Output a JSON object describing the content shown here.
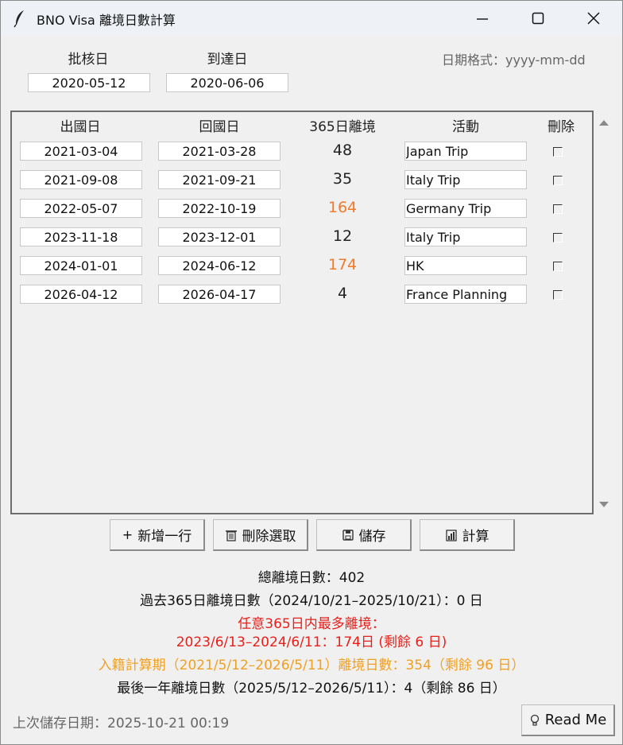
{
  "window": {
    "title": "BNO Visa 離境日數計算"
  },
  "header": {
    "approval_label": "批核日",
    "arrival_label": "到達日",
    "approval_value": "2020-05-12",
    "arrival_value": "2020-06-06",
    "date_format_hint": "日期格式：yyyy-mm-dd"
  },
  "table": {
    "columns": [
      "出國日",
      "回國日",
      "365日離境",
      "活動",
      "刪除"
    ],
    "rows": [
      {
        "depart": "2021-03-04",
        "return": "2021-03-28",
        "days": "48",
        "activity": "Japan Trip",
        "highlight": false
      },
      {
        "depart": "2021-09-08",
        "return": "2021-09-21",
        "days": "35",
        "activity": "Italy Trip",
        "highlight": false
      },
      {
        "depart": "2022-05-07",
        "return": "2022-10-19",
        "days": "164",
        "activity": "Germany Trip",
        "highlight": true
      },
      {
        "depart": "2023-11-18",
        "return": "2023-12-01",
        "days": "12",
        "activity": "Italy Trip",
        "highlight": false
      },
      {
        "depart": "2024-01-01",
        "return": "2024-06-12",
        "days": "174",
        "activity": "HK",
        "highlight": true
      },
      {
        "depart": "2026-04-12",
        "return": "2026-04-17",
        "days": "4",
        "activity": "France Planning",
        "highlight": false
      }
    ]
  },
  "buttons": {
    "add_row": "新增一行",
    "delete_selected": "刪除選取",
    "save": "儲存",
    "calculate": "計算",
    "readme": "Read Me"
  },
  "summary": {
    "total": "總離境日數：402",
    "past_365": "過去365日離境日數（2024/10/21–2025/10/21）：0 日",
    "max_line1": "任意365日内最多離境：",
    "max_line2": "2023/6/13–2024/6/11：174日 (剩餘 6 日)",
    "naturalisation": "入籍計算期（2021/5/12–2026/5/11）離境日數：354（剩餘 96 日）",
    "last_year": "最後一年離境日數（2025/5/12–2026/5/11）：4（剩餘 86 日）"
  },
  "footer": {
    "last_saved": "上次儲存日期：2025-10-21 00:19"
  },
  "colors": {
    "warning_orange": "#ef7a2a",
    "red": "#e8201a",
    "amber": "#f0a020"
  },
  "icons": [
    "feather-icon",
    "minimize-icon",
    "maximize-icon",
    "close-icon",
    "plus-icon",
    "trash-icon",
    "floppy-disk-icon",
    "bar-chart-icon",
    "lightbulb-icon",
    "scroll-up-icon",
    "scroll-down-icon",
    "checkbox"
  ]
}
